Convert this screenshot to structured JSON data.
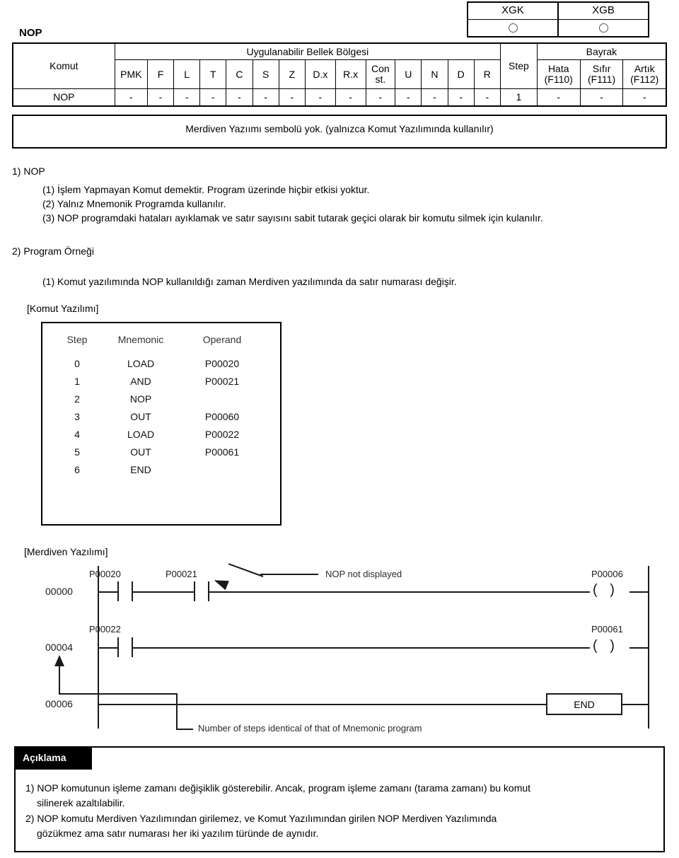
{
  "model_box": {
    "headers": [
      "XGK",
      "XGB"
    ],
    "marks": [
      "circle",
      "circle"
    ]
  },
  "instruction": {
    "title": "NOP",
    "table": {
      "col_command_header": "Komut",
      "group_memory_header": "Uygulanabilir Bellek Bölgesi",
      "memory_columns": [
        "PMK",
        "F",
        "L",
        "T",
        "C",
        "S",
        "Z",
        "D.x",
        "R.x",
        "Con st.",
        "U",
        "N",
        "D",
        "R"
      ],
      "memory_const_line1": "Con",
      "memory_const_line2": "st.",
      "step_header": "Step",
      "group_flag_header": "Bayrak",
      "flag_columns": [
        {
          "name": "Hata",
          "code": "(F110)"
        },
        {
          "name": "Sıfır",
          "code": "(F111)"
        },
        {
          "name": "Artık",
          "code": "(F112)"
        }
      ],
      "row": {
        "command": "NOP",
        "memory_values": [
          "-",
          "-",
          "-",
          "-",
          "-",
          "-",
          "-",
          "-",
          "-",
          "-",
          "-",
          "-",
          "-",
          "-"
        ],
        "step": "1",
        "flag_values": [
          "-",
          "-",
          "-"
        ]
      }
    },
    "symbol_note": "Merdiven Yazıımı sembolü yok. (yalnızca Komut Yazılımında kullanılır)"
  },
  "body": {
    "section1_heading": "1) NOP",
    "section1_items": [
      "(1) İşlem Yapmayan Komut demektir. Program üzerinde hiçbir etkisi yoktur.",
      "(2) Yalnız Mnemonik Programda kullanılır.",
      "(3) NOP programdaki hataları ayıklamak ve satır sayısını sabit tutarak geçici olarak bir komutu silmek için kulanılır."
    ],
    "section2_heading": "2) Program Örneği",
    "section2_items": [
      "(1) Komut yazılımında NOP kullanıldığı zaman Merdiven yazılımında da satır numarası değişir."
    ]
  },
  "mnemonic": {
    "label": "[Komut Yazılımı]",
    "headers": [
      "Step",
      "Mnemonic",
      "Operand"
    ],
    "rows": [
      {
        "step": "0",
        "mnemonic": "LOAD",
        "operand": "P00020"
      },
      {
        "step": "1",
        "mnemonic": "AND",
        "operand": "P00021"
      },
      {
        "step": "2",
        "mnemonic": "NOP",
        "operand": ""
      },
      {
        "step": "3",
        "mnemonic": "OUT",
        "operand": "P00060"
      },
      {
        "step": "4",
        "mnemonic": "LOAD",
        "operand": "P00022"
      },
      {
        "step": "5",
        "mnemonic": "OUT",
        "operand": "P00061"
      },
      {
        "step": "6",
        "mnemonic": "END",
        "operand": ""
      }
    ]
  },
  "ladder": {
    "label": "[Merdiven Yazılımı]",
    "rung_numbers": [
      "00000",
      "00004",
      "00006"
    ],
    "rung1": {
      "contacts": [
        "P00020",
        "P00021"
      ],
      "coil": "P00006",
      "coil_symbol": "( )"
    },
    "rung2": {
      "contacts": [
        "P00022"
      ],
      "coil": "P00061",
      "coil_symbol": "( )"
    },
    "rung3": {
      "end_label": "END"
    },
    "annotation_nop": "NOP not displayed",
    "annotation_steps": "Number of steps identical of that of Mnemonic program"
  },
  "note": {
    "tag": "Açıklama",
    "items": [
      {
        "line1": "1) NOP komutunun işleme zamanı değişiklik gösterebilir. Ancak, program işleme zamanı (tarama zamanı) bu komut",
        "line2": "silinerek azaltılabilir."
      },
      {
        "line1": "2) NOP komutu Merdiven Yazılımından girilemez, ve Komut Yazılımından girilen NOP Merdiven Yazılımında",
        "line2": "gözükmez ama satır numarası her iki yazılım türünde de  aynıdır."
      }
    ]
  }
}
